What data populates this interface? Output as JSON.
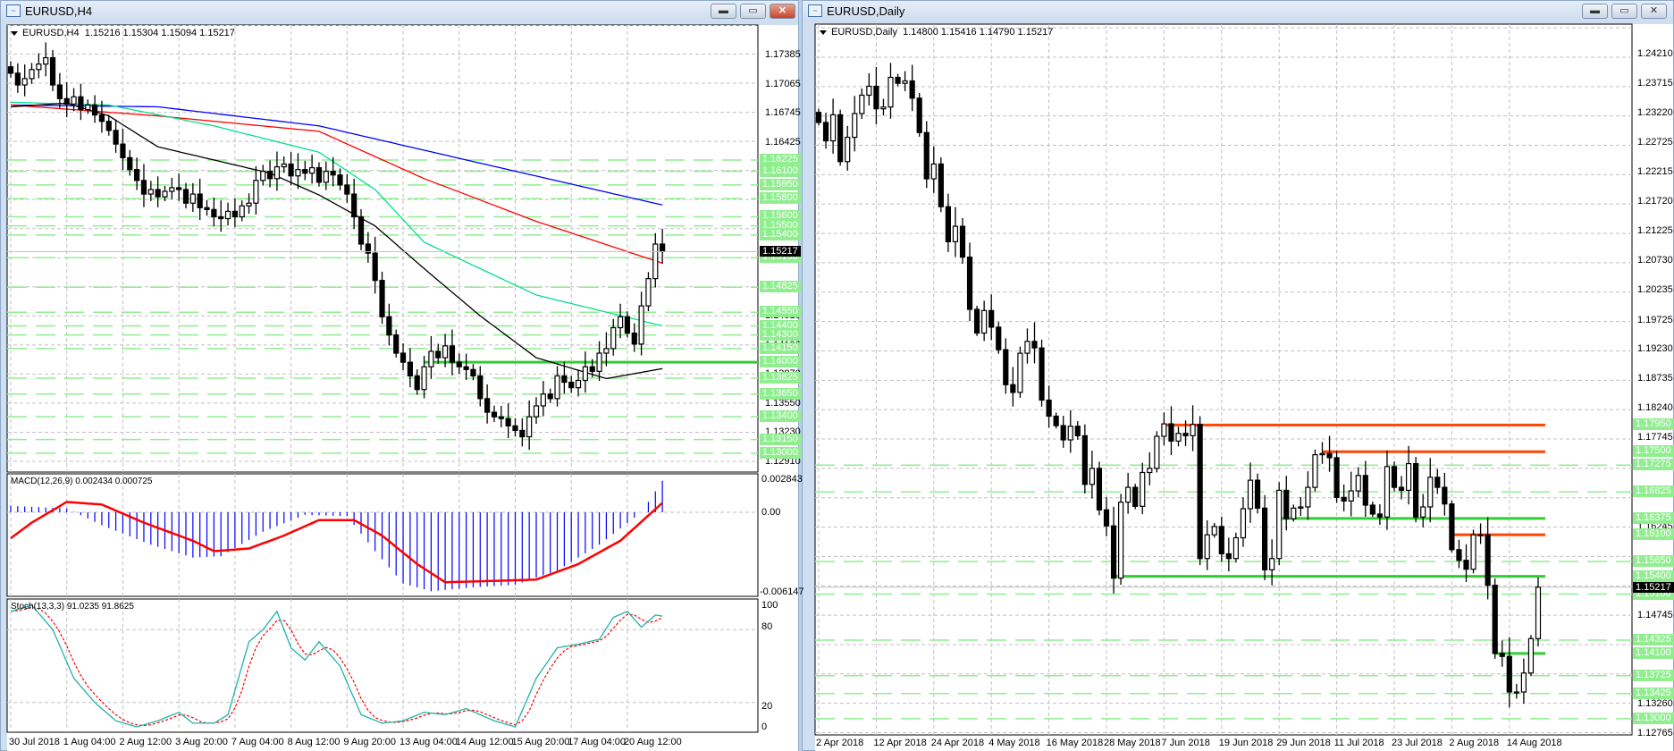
{
  "left_window": {
    "title": "EURUSD,H4",
    "header": {
      "symbol": "EURUSD,H4",
      "ohlc": "1.15216 1.15304 1.15094 1.15217"
    },
    "buttons": {
      "minimize": "▬",
      "maximize": "▭",
      "close": "✕"
    },
    "price_ticks": [
      "1.17385",
      "1.17065",
      "1.16745",
      "1.16425",
      "1.14510",
      "1.14190",
      "1.13870",
      "1.13550",
      "1.13230",
      "1.12910"
    ],
    "level_labels": [
      "1.16225",
      "1.16100",
      "1.15950",
      "1.15800",
      "1.15600",
      "1.15500",
      "1.15400",
      "1.15150",
      "1.14825",
      "1.14550",
      "1.14400",
      "1.14300",
      "1.14150",
      "1.14000",
      "1.13825",
      "1.13650",
      "1.13400",
      "1.13150",
      "1.13000"
    ],
    "current_price": "1.15217",
    "time_labels": [
      {
        "i": -8,
        "t": "30 Jul 2018"
      },
      {
        "i": 0,
        "t": "1 Aug 04:00"
      },
      {
        "i": 8,
        "t": "2 Aug 12:00"
      },
      {
        "i": 16,
        "t": "3 Aug 20:00"
      },
      {
        "i": 24,
        "t": "7 Aug 04:00"
      },
      {
        "i": 32,
        "t": "8 Aug 12:00"
      },
      {
        "i": 40,
        "t": "9 Aug 20:00"
      },
      {
        "i": 48,
        "t": "13 Aug 04:00"
      },
      {
        "i": 56,
        "t": "14 Aug 12:00"
      },
      {
        "i": 64,
        "t": "15 Aug 20:00"
      },
      {
        "i": 72,
        "t": "17 Aug 04:00"
      },
      {
        "i": 80,
        "t": "20 Aug 12:00"
      }
    ],
    "macd": {
      "label": "MACD(12,26,9) 0.002434 0.000725",
      "scale_top": "0.002843",
      "scale_zero": "0.00",
      "scale_bottom": "-0.006147"
    },
    "stoch": {
      "label": "Stoch(13,3,3) 91.0235 91.8625",
      "scale": [
        "100",
        "80",
        "20",
        "0"
      ]
    }
  },
  "right_window": {
    "title": "EURUSD,Daily",
    "header": {
      "symbol": "EURUSD,Daily",
      "ohlc": "1.14800 1.15416 1.14790 1.15217"
    },
    "buttons": {
      "minimize": "▬",
      "maximize": "▭",
      "close": "✕"
    },
    "price_ticks": [
      "1.24210",
      "1.23715",
      "1.23220",
      "1.22725",
      "1.22215",
      "1.21720",
      "1.21225",
      "1.20730",
      "1.20235",
      "1.19725",
      "1.19230",
      "1.18735",
      "1.18240",
      "1.17745",
      "1.16245",
      "1.14745",
      "1.13260",
      "1.12765"
    ],
    "level_labels": [
      "1.17950",
      "1.17500",
      "1.17275",
      "1.16825",
      "1.16375",
      "1.16100",
      "1.15650",
      "1.15400",
      "1.15100",
      "1.14325",
      "1.14100",
      "1.13725",
      "1.13425",
      "1.13000"
    ],
    "current_price": "1.15217",
    "time_labels": [
      {
        "i": 0,
        "t": "2 Apr 2018"
      },
      {
        "i": 8,
        "t": "12 Apr 2018"
      },
      {
        "i": 16,
        "t": "24 Apr 2018"
      },
      {
        "i": 24,
        "t": "4 May 2018"
      },
      {
        "i": 32,
        "t": "16 May 2018"
      },
      {
        "i": 40,
        "t": "28 May 2018"
      },
      {
        "i": 48,
        "t": "7 Jun 2018"
      },
      {
        "i": 56,
        "t": "19 Jun 2018"
      },
      {
        "i": 64,
        "t": "29 Jun 2018"
      },
      {
        "i": 72,
        "t": "11 Jul 2018"
      },
      {
        "i": 80,
        "t": "23 Jul 2018"
      },
      {
        "i": 88,
        "t": "2 Aug 2018"
      },
      {
        "i": 96,
        "t": "14 Aug 2018"
      }
    ]
  },
  "colors": {
    "bull": "#ffffff",
    "bear": "#000000",
    "ma_blue": "#0000ff",
    "ma_red": "#ff0000",
    "ma_green": "#00e08a",
    "ma_black": "#000000",
    "level_light": "#90ee90",
    "level_green": "#32cd32",
    "level_orange": "#ff4500",
    "macd_hist": "#0000ff",
    "macd_signal": "#ff0000",
    "stoch_main": "#20b2aa",
    "stoch_signal": "#ff0000",
    "grid": "#c0c0c0"
  },
  "chart_data": [
    {
      "type": "candlestick",
      "title": "EURUSD,H4",
      "x_start_index": -8,
      "open_first": 1.1725,
      "closes": [
        1.1718,
        1.1705,
        1.1712,
        1.1722,
        1.1728,
        1.1735,
        1.1705,
        1.169,
        1.1684,
        1.1692,
        1.1678,
        1.1683,
        1.1672,
        1.1665,
        1.1655,
        1.164,
        1.1625,
        1.1612,
        1.16,
        1.1585,
        1.159,
        1.1582,
        1.1588,
        1.1592,
        1.159,
        1.1575,
        1.1585,
        1.157,
        1.1568,
        1.156,
        1.1558,
        1.1566,
        1.156,
        1.1572,
        1.1575,
        1.16,
        1.161,
        1.1602,
        1.1615,
        1.1618,
        1.1605,
        1.1612,
        1.1608,
        1.1614,
        1.1598,
        1.161,
        1.1606,
        1.1595,
        1.1585,
        1.156,
        1.153,
        1.152,
        1.149,
        1.145,
        1.143,
        1.141,
        1.14,
        1.1385,
        1.137,
        1.1395,
        1.1412,
        1.1405,
        1.1418,
        1.14,
        1.1395,
        1.1392,
        1.1385,
        1.136,
        1.1345,
        1.134,
        1.1338,
        1.133,
        1.1325,
        1.1318,
        1.134,
        1.1352,
        1.1365,
        1.136,
        1.1385,
        1.1378,
        1.1372,
        1.138,
        1.1395,
        1.139,
        1.141,
        1.1415,
        1.1438,
        1.145,
        1.1432,
        1.142,
        1.1462,
        1.1492,
        1.153,
        1.15217
      ],
      "ylim": [
        1.12792,
        1.177
      ],
      "moving_averages": [
        {
          "name": "MA blue",
          "points": [
            [
              -8,
              1.1683
            ],
            [
              13,
              1.1681
            ],
            [
              36,
              1.166
            ],
            [
              59,
              1.1619
            ],
            [
              85,
              1.1573
            ]
          ]
        },
        {
          "name": "MA red",
          "points": [
            [
              -8,
              1.1683
            ],
            [
              13,
              1.1671
            ],
            [
              36,
              1.1654
            ],
            [
              51,
              1.1602
            ],
            [
              67,
              1.1555
            ],
            [
              85,
              1.1509
            ]
          ]
        },
        {
          "name": "MA green",
          "points": [
            [
              -8,
              1.1686
            ],
            [
              6,
              1.1683
            ],
            [
              21,
              1.166
            ],
            [
              36,
              1.1631
            ],
            [
              44,
              1.159
            ],
            [
              51,
              1.1532
            ],
            [
              67,
              1.1474
            ],
            [
              85,
              1.144
            ]
          ]
        },
        {
          "name": "MA black",
          "points": [
            [
              -8,
              1.1681
            ],
            [
              0,
              1.1685
            ],
            [
              6,
              1.1671
            ],
            [
              13,
              1.1637
            ],
            [
              29,
              1.1608
            ],
            [
              36,
              1.1584
            ],
            [
              44,
              1.155
            ],
            [
              51,
              1.1503
            ],
            [
              59,
              1.1451
            ],
            [
              67,
              1.1405
            ],
            [
              77,
              1.1382
            ],
            [
              85,
              1.1393
            ]
          ]
        }
      ],
      "levels": [
        {
          "value": 1.14,
          "style": "green",
          "from_index": 51
        },
        {
          "value": 1.16225,
          "style": "light"
        },
        {
          "value": 1.161,
          "style": "light"
        },
        {
          "value": 1.1595,
          "style": "light"
        },
        {
          "value": 1.158,
          "style": "light"
        },
        {
          "value": 1.156,
          "style": "light"
        },
        {
          "value": 1.155,
          "style": "light"
        },
        {
          "value": 1.154,
          "style": "light"
        },
        {
          "value": 1.1515,
          "style": "light"
        },
        {
          "value": 1.14825,
          "style": "light"
        },
        {
          "value": 1.1455,
          "style": "light"
        },
        {
          "value": 1.144,
          "style": "light"
        },
        {
          "value": 1.143,
          "style": "light"
        },
        {
          "value": 1.1415,
          "style": "light"
        },
        {
          "value": 1.13825,
          "style": "light"
        },
        {
          "value": 1.1365,
          "style": "light"
        },
        {
          "value": 1.134,
          "style": "light"
        },
        {
          "value": 1.1315,
          "style": "light"
        },
        {
          "value": 1.13,
          "style": "light"
        }
      ]
    },
    {
      "type": "bar",
      "title": "MACD(12,26,9)",
      "ylim": [
        -0.006147,
        0.002843
      ],
      "main_points": [
        [
          -8,
          0.0005
        ],
        [
          0,
          0.0003
        ],
        [
          5,
          -0.001
        ],
        [
          12,
          -0.0025
        ],
        [
          18,
          -0.0035
        ],
        [
          22,
          -0.0034
        ],
        [
          28,
          -0.0015
        ],
        [
          34,
          -0.0002
        ],
        [
          40,
          -0.0003
        ],
        [
          44,
          -0.003
        ],
        [
          48,
          -0.0055
        ],
        [
          52,
          -0.0061
        ],
        [
          58,
          -0.0058
        ],
        [
          64,
          -0.0056
        ],
        [
          70,
          -0.0045
        ],
        [
          76,
          -0.0025
        ],
        [
          82,
          0.0
        ],
        [
          85,
          0.002434
        ]
      ],
      "signal_points": [
        [
          -8,
          -0.002
        ],
        [
          -5,
          -0.0008
        ],
        [
          0,
          0.0008
        ],
        [
          5,
          0.0006
        ],
        [
          11,
          -0.0008
        ],
        [
          18,
          -0.0022
        ],
        [
          21,
          -0.003
        ],
        [
          26,
          -0.0028
        ],
        [
          31,
          -0.0018
        ],
        [
          36,
          -0.0006
        ],
        [
          41,
          -0.0006
        ],
        [
          45,
          -0.0018
        ],
        [
          50,
          -0.004
        ],
        [
          54,
          -0.0054
        ],
        [
          61,
          -0.0053
        ],
        [
          67,
          -0.0052
        ],
        [
          73,
          -0.004
        ],
        [
          79,
          -0.0022
        ],
        [
          85,
          0.000725
        ]
      ]
    },
    {
      "type": "line",
      "title": "Stoch(13,3,3)",
      "ylim": [
        0,
        100
      ],
      "main_points": [
        [
          -8,
          95
        ],
        [
          -5,
          100
        ],
        [
          -2,
          80
        ],
        [
          1,
          40
        ],
        [
          4,
          20
        ],
        [
          7,
          5
        ],
        [
          10,
          0
        ],
        [
          13,
          5
        ],
        [
          16,
          12
        ],
        [
          18,
          3
        ],
        [
          21,
          3
        ],
        [
          23,
          10
        ],
        [
          26,
          70
        ],
        [
          28,
          80
        ],
        [
          30,
          95
        ],
        [
          32,
          65
        ],
        [
          34,
          55
        ],
        [
          36,
          70
        ],
        [
          39,
          50
        ],
        [
          42,
          10
        ],
        [
          45,
          3
        ],
        [
          48,
          5
        ],
        [
          51,
          12
        ],
        [
          54,
          10
        ],
        [
          57,
          15
        ],
        [
          61,
          5
        ],
        [
          64,
          0
        ],
        [
          67,
          40
        ],
        [
          70,
          65
        ],
        [
          73,
          68
        ],
        [
          76,
          72
        ],
        [
          78,
          90
        ],
        [
          80,
          95
        ],
        [
          82,
          82
        ],
        [
          84,
          92
        ],
        [
          85,
          91.02
        ]
      ]
    },
    {
      "type": "candlestick",
      "title": "EURUSD,Daily",
      "open_first": 1.2322,
      "closes": [
        1.2305,
        1.2274,
        1.2318,
        1.2239,
        1.228,
        1.232,
        1.2351,
        1.2366,
        1.2328,
        1.2331,
        1.2381,
        1.2371,
        1.2375,
        1.2346,
        1.2288,
        1.221,
        1.2235,
        1.2163,
        1.2104,
        1.213,
        1.2078,
        1.199,
        1.195,
        1.1988,
        1.196,
        1.1922,
        1.1863,
        1.185,
        1.1916,
        1.1936,
        1.1925,
        1.1837,
        1.181,
        1.1794,
        1.177,
        1.1793,
        1.1777,
        1.1695,
        1.1722,
        1.1652,
        1.1625,
        1.1537,
        1.1665,
        1.169,
        1.1658,
        1.1715,
        1.1722,
        1.1776,
        1.1797,
        1.1768,
        1.1781,
        1.1777,
        1.1796,
        1.157,
        1.161,
        1.1624,
        1.1578,
        1.157,
        1.1605,
        1.1654,
        1.1702,
        1.1655,
        1.1551,
        1.157,
        1.1685,
        1.1637,
        1.1655,
        1.1657,
        1.169,
        1.1745,
        1.1747,
        1.174,
        1.1673,
        1.1667,
        1.1684,
        1.171,
        1.166,
        1.1645,
        1.164,
        1.1725,
        1.169,
        1.1685,
        1.173,
        1.164,
        1.1657,
        1.1707,
        1.169,
        1.1662,
        1.1585,
        1.1567,
        1.1552,
        1.161,
        1.161,
        1.1525,
        1.141,
        1.1405,
        1.1345,
        1.1345,
        1.1377,
        1.1435,
        1.15217
      ],
      "ylim": [
        1.1266,
        1.247
      ],
      "levels": [
        {
          "value": 1.1795,
          "style": "orange",
          "from_index": 48
        },
        {
          "value": 1.175,
          "style": "orange",
          "from_index": 70
        },
        {
          "value": 1.16375,
          "style": "green",
          "from_index": 64
        },
        {
          "value": 1.161,
          "style": "orange",
          "from_index": 88
        },
        {
          "value": 1.154,
          "style": "green",
          "from_index": 41
        },
        {
          "value": 1.141,
          "style": "green",
          "from_index": 94
        },
        {
          "value": 1.17275,
          "style": "light"
        },
        {
          "value": 1.16825,
          "style": "light"
        },
        {
          "value": 1.1565,
          "style": "light"
        },
        {
          "value": 1.151,
          "style": "light"
        },
        {
          "value": 1.14325,
          "style": "light"
        },
        {
          "value": 1.13725,
          "style": "light"
        },
        {
          "value": 1.13425,
          "style": "light"
        },
        {
          "value": 1.13,
          "style": "light"
        }
      ]
    }
  ]
}
